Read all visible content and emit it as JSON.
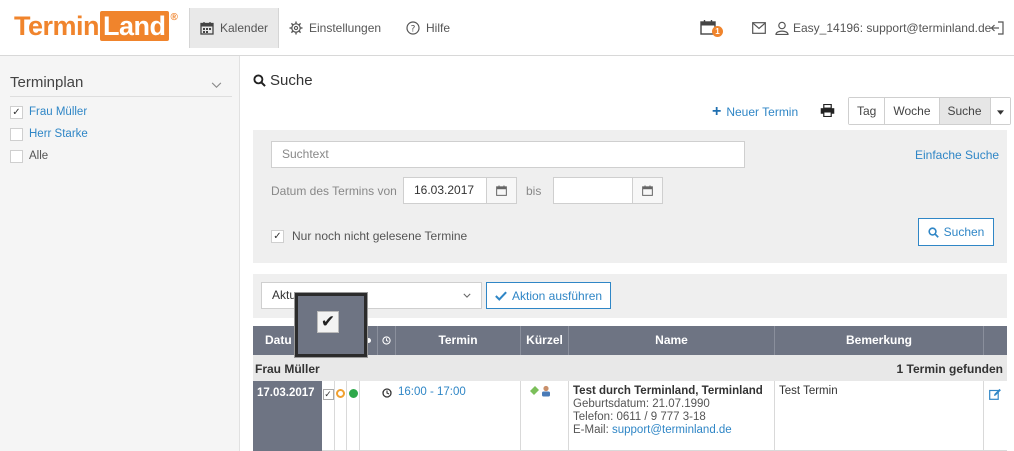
{
  "app": {
    "logo_part1": "Termin",
    "logo_part2": "Land",
    "logo_reg": "®"
  },
  "nav": {
    "tabs": [
      {
        "label": "Kalender",
        "icon": "calendar-icon",
        "active": true
      },
      {
        "label": "Einstellungen",
        "icon": "gear-icon",
        "active": false
      },
      {
        "label": "Hilfe",
        "icon": "help-icon",
        "active": false
      }
    ],
    "notification_count": "1",
    "account_label": "Easy_14196: support@terminland.de"
  },
  "sidebar": {
    "title": "Terminplan",
    "items": [
      {
        "label": "Frau Müller",
        "checked": true
      },
      {
        "label": "Herr Starke",
        "checked": false
      },
      {
        "label": "Alle",
        "checked": false
      }
    ]
  },
  "main": {
    "title": "Suche",
    "new_appointment": "Neuer Termin",
    "views": [
      "Tag",
      "Woche",
      "Suche"
    ],
    "active_view": "Suche"
  },
  "search": {
    "text_placeholder": "Suchtext",
    "simple_search_link": "Einfache Suche",
    "date_label": "Datum des Termins von",
    "date_from": "16.03.2017",
    "to_label": "bis",
    "date_to": "",
    "unread_only_label": "Nur noch nicht gelesene Termine",
    "unread_only_checked": true,
    "submit_label": "Suchen"
  },
  "actions": {
    "select_value_visible": "Aktu",
    "execute_label": "Aktion ausführen"
  },
  "table": {
    "headers": {
      "date": "Datu",
      "appointment": "Termin",
      "short": "Kürzel",
      "name": "Name",
      "remark": "Bemerkung"
    },
    "group": {
      "name": "Frau Müller",
      "count_text": "1 Termin gefunden"
    },
    "rows": [
      {
        "date": "17.03.2017",
        "time": "16:00 - 17:00",
        "name_bold": "Test durch Terminland, Terminland",
        "birth": "Geburtsdatum: 21.07.1990",
        "phone": "Telefon: 0611 / 9 777 3-18",
        "email_label": "E-Mail:",
        "email": "support@terminland.de",
        "remark": "Test Termin"
      }
    ]
  },
  "colors": {
    "brand_orange": "#f0842c",
    "link_blue": "#2f86c6",
    "header_gray": "#6e7483",
    "status_orange": "#f0a030",
    "status_green": "#2ea84a"
  }
}
